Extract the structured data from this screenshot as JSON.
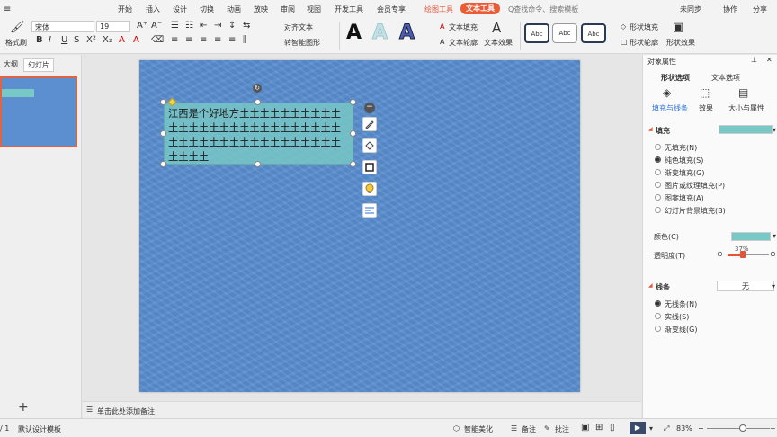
{
  "menubar": {
    "items": [
      "开始",
      "插入",
      "设计",
      "切换",
      "动画",
      "放映",
      "审阅",
      "视图",
      "开发工具",
      "会员专享"
    ],
    "context_tab": "绘图工具",
    "active_tab": "文本工具",
    "search_placeholder": "Q查找命令、搜索模板",
    "sync": "未同步",
    "collab": "协作",
    "share": "分享"
  },
  "ribbon": {
    "format_painter": "格式刷",
    "font_name": "宋体",
    "font_size": "19",
    "align_text": "对齐文本",
    "convert_smartart": "转智能图形",
    "text_fill": "文本填充",
    "text_outline": "文本轮廓",
    "text_effects": "文本效果",
    "style_sample": "Abc",
    "shape_fill": "形状填充",
    "shape_outline": "形状轮廓",
    "shape_effects": "形状效果"
  },
  "left_panel": {
    "tab_outline": "大纲",
    "tab_slides": "幻灯片",
    "slide_number": "1",
    "add_icon": "+"
  },
  "slide": {
    "textbox_text": "江西是个好地方土土土土土土土土土土土土土土土土土土土土土土土土土土土土土土土土土土土土土土土土土土土土土土土土"
  },
  "notes": {
    "placeholder": "单击此处添加备注"
  },
  "right_pane": {
    "title": "对象属性",
    "tab_shape": "形状选项",
    "tab_text": "文本选项",
    "sub_fill_line": "填充与线条",
    "sub_effects": "效果",
    "sub_size": "大小与属性",
    "fill_section": "填充",
    "fill_options": [
      "无填充(N)",
      "纯色填充(S)",
      "渐变填充(G)",
      "图片或纹理填充(P)",
      "图案填充(A)",
      "幻灯片背景填充(B)"
    ],
    "fill_selected_index": 1,
    "color_label": "颜色(C)",
    "transparency_label": "透明度(T)",
    "transparency_value": "37%",
    "line_section": "线条",
    "line_dropdown": "无",
    "line_options": [
      "无线条(N)",
      "实线(S)",
      "渐变线(G)"
    ],
    "line_selected_index": 0,
    "fill_color": "#78c8c6"
  },
  "statusbar": {
    "page": "/ 1",
    "template": "默认设计模板",
    "smart_beautify": "智能美化",
    "notes": "备注",
    "comments": "批注",
    "zoom": "83%"
  }
}
